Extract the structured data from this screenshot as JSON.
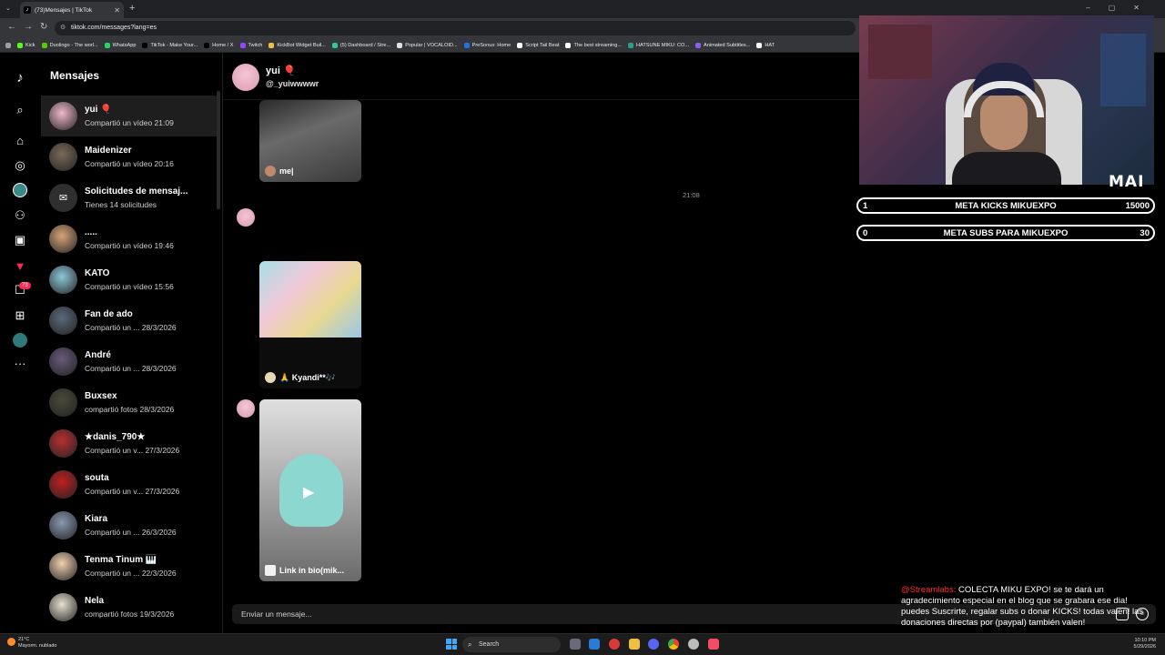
{
  "browser": {
    "tab_title": "(73)Mensajes | TikTok",
    "url": "tiktok.com/messages?lang=es",
    "bookmarks": [
      "Kick",
      "Duolingo - The worl...",
      "WhatsApp",
      "TikTok - Make Your...",
      "Home / X",
      "Twitch",
      "KickBot Widget Buil...",
      "(5) Dashboard / Stre...",
      "Popular | VOCALOID...",
      "PreSonus: Home",
      "Script Tail Beat",
      "The best streaming...",
      "HATSUNE MIKU: CO...",
      "Animated Subtitles...",
      "HAT"
    ],
    "colors": {
      "tabbar": "#202124",
      "toolbar": "#35363a"
    }
  },
  "rail": {
    "badge": "73",
    "icons": [
      "tiktok-logo-icon",
      "search-icon",
      "home-icon",
      "explore-icon",
      "following-icon",
      "friends-icon",
      "live-icon",
      "activity-icon",
      "messages-icon",
      "upload-icon",
      "profile-icon",
      "more-icon"
    ]
  },
  "sidebar": {
    "title": "Mensajes",
    "conversations": [
      {
        "name": "yui 🎈",
        "sub": "Compartió un vídeo 21:09",
        "color": "#f0b8cb",
        "active": true
      },
      {
        "name": "Maidenizer",
        "sub": "Compartió un vídeo 20:16",
        "color": "#7a6a5a",
        "active": false
      },
      {
        "name": "Solicitudes de mensaj...",
        "sub": "Tienes 14 solicitudes",
        "color": "#3a3a3a",
        "active": false
      },
      {
        "name": ".....",
        "sub": "Compartió un vídeo 19:46",
        "color": "#d8a57a",
        "active": false
      },
      {
        "name": "KATO",
        "sub": "Compartió un vídeo 15:56",
        "color": "#8cc8d8",
        "active": false
      },
      {
        "name": "Fan de ado",
        "sub": "Compartió un ...   28/3/2026",
        "color": "#5a6a7a",
        "active": false
      },
      {
        "name": "André",
        "sub": "Compartió un ...   28/3/2026",
        "color": "#6a5a7a",
        "active": false
      },
      {
        "name": "Buxsex",
        "sub": "compartió fotos 28/3/2026",
        "color": "#4a4a3a",
        "active": false
      },
      {
        "name": "★danis_790★",
        "sub": "Compartió un v...   27/3/2026",
        "color": "#b83030",
        "active": false
      },
      {
        "name": "souta",
        "sub": "Compartió un v...   27/3/2026",
        "color": "#c02020",
        "active": false
      },
      {
        "name": "Kiara",
        "sub": "Compartió un ...   26/3/2026",
        "color": "#8a9ab0",
        "active": false
      },
      {
        "name": "Tenma Tinum 🎹",
        "sub": "Compartió un ...   22/3/2026",
        "color": "#f0d0b0",
        "active": false
      },
      {
        "name": "Nela",
        "sub": "compartió fotos 19/3/2026",
        "color": "#e8e0d0",
        "active": false
      }
    ]
  },
  "chat": {
    "name": "yui 🎈",
    "handle": "@_yuiwwwwr",
    "timestamp": "21:08",
    "videos": [
      {
        "caption": "me|",
        "colors": [
          "#3a3a3a",
          "#8a8a8a"
        ]
      },
      {
        "caption": "🙏 Kyandi**🎶",
        "colors": [
          "#a8e0e8",
          "#f0c8d8"
        ]
      },
      {
        "caption": "Link in bio(mik...",
        "colors": [
          "#d8d8d8",
          "#8cd8d0"
        ]
      }
    ],
    "input_placeholder": "Enviar un mensaje..."
  },
  "overlay": {
    "logo": "MAI",
    "goals": [
      {
        "current": "1",
        "label": "META KICKS MIKUEXPO",
        "target": "15000"
      },
      {
        "current": "0",
        "label": "META SUBS PARA MIKUEXPO",
        "target": "30"
      }
    ],
    "alert_source": "@Streamlabs:",
    "alert_text": "COLECTA MIKU EXPO! se te dará un agradecimiento especial en el blog que se grabara ese dia! puedes Suscrirte, regalar subs o donar KICKS! todas valen! las donaciones directas por (paypal) también valen!"
  },
  "taskbar": {
    "weather_temp": "21°C",
    "weather_desc": "Mayorm. nublado",
    "search_label": "Search",
    "time": "10:10 PM",
    "date": "5/29/2026"
  }
}
